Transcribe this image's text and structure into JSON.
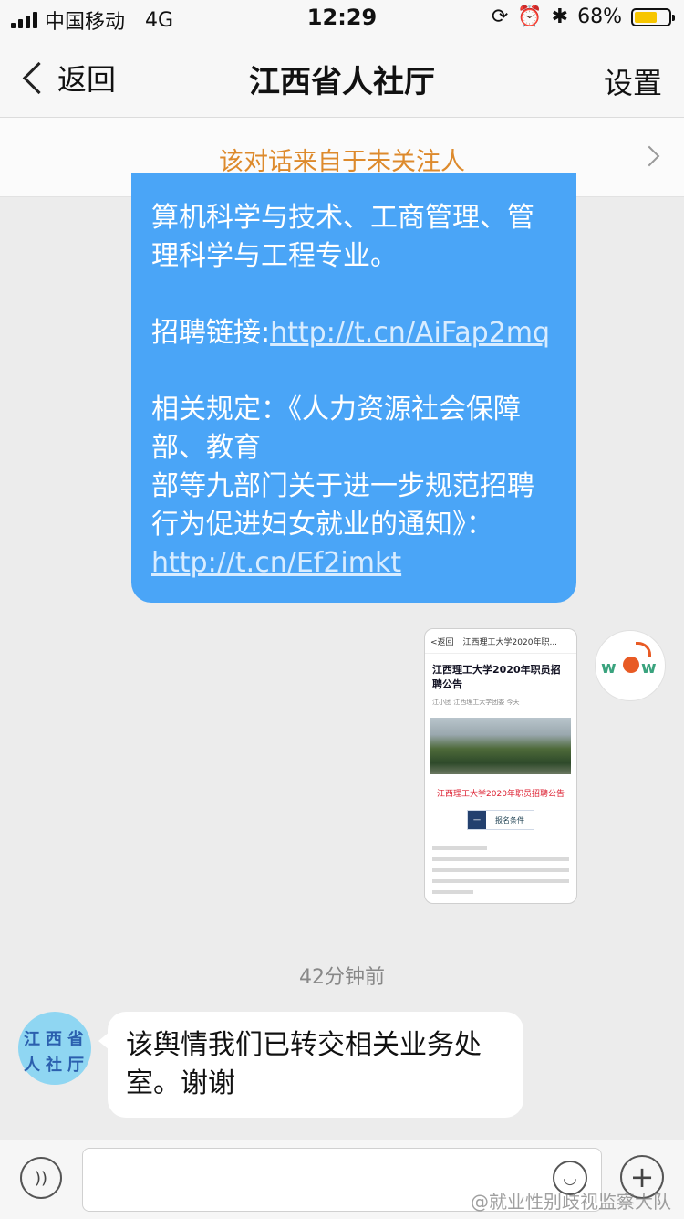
{
  "status_bar": {
    "carrier": "中国移动",
    "network": "4G",
    "time": "12:29",
    "battery_percent": "68%",
    "battery_level": 0.68,
    "icons": [
      "signal-icon",
      "rotation-lock-icon",
      "alarm-icon",
      "bluetooth-icon",
      "battery-icon"
    ]
  },
  "nav": {
    "back_label": "返回",
    "title": "江西省人社厅",
    "settings_label": "设置"
  },
  "notice": {
    "text": "该对话来自于未关注人"
  },
  "outgoing_message": {
    "line1": "算机科学与技术、工商管理、管",
    "line2": "理科学与工程专业。",
    "link1_label": "招聘链接:",
    "link1_url": "http://t.cn/AiFap2mq",
    "rule_line1": "相关规定：《人力资源社会保障",
    "rule_line2": "部、教育",
    "rule_line3": "部等九部门关于进一步规范招聘",
    "rule_line4": "行为促进妇女就业的通知》：",
    "link2_url": "http://t.cn/Ef2imkt",
    "bubble_color": "#4aa5f7"
  },
  "outgoing_image": {
    "top_back": "<返回",
    "top_title": "江西理工大学2020年职...",
    "heading": "江西理工大学2020年职员招聘公告",
    "meta": "江小团   江西理工大学团委   今天",
    "red_title": "江西理工大学2020年职员招聘公告",
    "btn_num": "一",
    "btn_label": "报名条件"
  },
  "timestamp": "42分钟前",
  "incoming_message": {
    "avatar_chars": [
      "江",
      "西",
      "省",
      "人",
      "社",
      "厅"
    ],
    "text": "该舆情我们已转交相关业务处室。谢谢"
  },
  "input_bar": {
    "voice_icon": "voice-icon",
    "emoji_icon": "emoji-icon",
    "plus_icon": "plus-icon"
  },
  "watermark": "@就业性别歧视监察大队",
  "colors": {
    "notice_text": "#dd8a2c",
    "link": "#d8ecff"
  }
}
